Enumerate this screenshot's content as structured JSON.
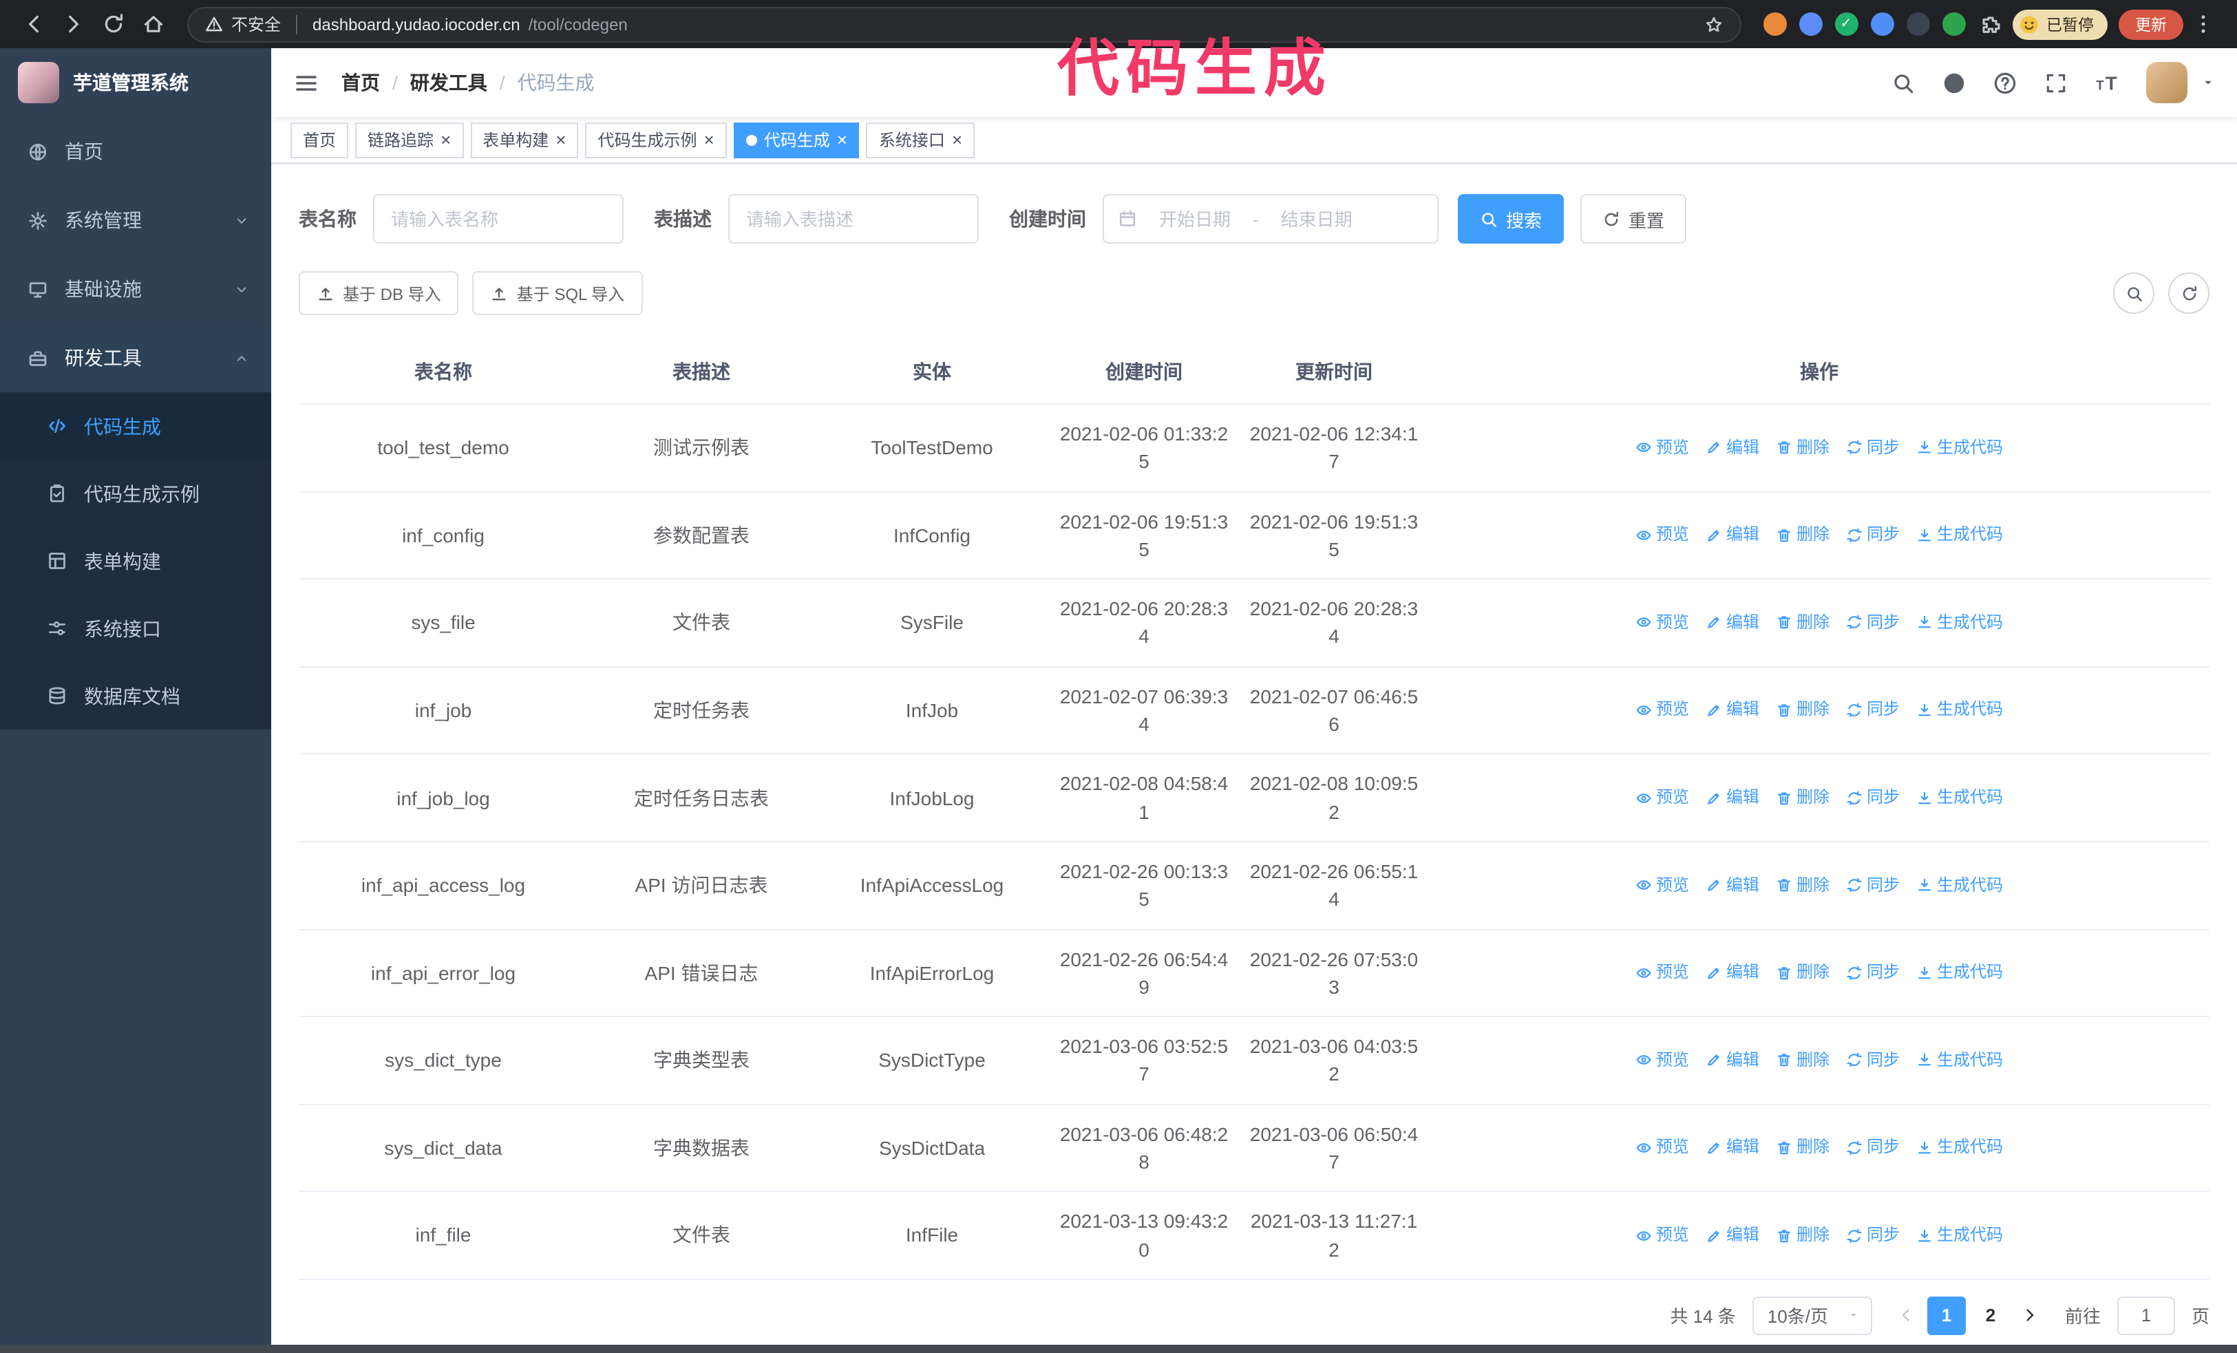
{
  "colors": {
    "accent": "#409eff",
    "annotation": "#f23a68",
    "sidebar_bg": "#304156",
    "submenu_bg": "#1f2d3d",
    "active_tab_bg": "#409eff"
  },
  "annotation": {
    "text": "代码生成",
    "color": "#f23a68"
  },
  "browser": {
    "security_label": "不安全",
    "url_host": "dashboard.yudao.iocoder.cn",
    "url_path": "/tool/codegen",
    "paused_badge": "已暂停",
    "update_button": "更新",
    "extensions": [
      {
        "name": "extension-orange-icon",
        "color": "#e98a3c"
      },
      {
        "name": "extension-blue-icon",
        "color": "#5b8cf7"
      },
      {
        "name": "extension-green-check-icon",
        "color": "#21b26e",
        "glyph": "✓"
      },
      {
        "name": "extension-share-icon",
        "color": "#4f8ef7"
      },
      {
        "name": "extension-switch-icon",
        "color": "#3b4350"
      },
      {
        "name": "extension-translate-icon",
        "color": "#2ea44f"
      }
    ]
  },
  "sidebar": {
    "app_title": "芋道管理系统",
    "items": [
      {
        "id": "home",
        "label": "首页",
        "icon": "home-icon",
        "has_children": false,
        "expanded": false
      },
      {
        "id": "system",
        "label": "系统管理",
        "icon": "gear-icon",
        "has_children": true,
        "expanded": false
      },
      {
        "id": "infra",
        "label": "基础设施",
        "icon": "infra-icon",
        "has_children": true,
        "expanded": false
      },
      {
        "id": "devtools",
        "label": "研发工具",
        "icon": "toolbox-icon",
        "has_children": true,
        "expanded": true,
        "children": [
          {
            "id": "codegen",
            "label": "代码生成",
            "icon": "code-icon",
            "active": true
          },
          {
            "id": "codegen-example",
            "label": "代码生成示例",
            "icon": "clipboard-icon",
            "active": false
          },
          {
            "id": "form-builder",
            "label": "表单构建",
            "icon": "form-icon",
            "active": false
          },
          {
            "id": "system-api",
            "label": "系统接口",
            "icon": "sliders-icon",
            "active": false
          },
          {
            "id": "db-doc",
            "label": "数据库文档",
            "icon": "database-icon",
            "active": false
          }
        ]
      }
    ]
  },
  "header": {
    "breadcrumb": [
      "首页",
      "研发工具",
      "代码生成"
    ],
    "separator": "/"
  },
  "tabbar": {
    "close_glyph": "×",
    "tabs": [
      {
        "label": "首页",
        "closable": false,
        "active": false
      },
      {
        "label": "链路追踪",
        "closable": true,
        "active": false
      },
      {
        "label": "表单构建",
        "closable": true,
        "active": false
      },
      {
        "label": "代码生成示例",
        "closable": true,
        "active": false
      },
      {
        "label": "代码生成",
        "closable": true,
        "active": true
      },
      {
        "label": "系统接口",
        "closable": true,
        "active": false
      }
    ]
  },
  "filters": {
    "table_name_label": "表名称",
    "table_name_placeholder": "请输入表名称",
    "table_desc_label": "表描述",
    "table_desc_placeholder": "请输入表描述",
    "create_time_label": "创建时间",
    "date_start_placeholder": "开始日期",
    "date_separator": "-",
    "date_end_placeholder": "结束日期",
    "search_button": "搜索",
    "reset_button": "重置"
  },
  "toolbar": {
    "import_db": "基于 DB 导入",
    "import_sql": "基于 SQL 导入"
  },
  "table": {
    "columns": [
      "表名称",
      "表描述",
      "实体",
      "创建时间",
      "更新时间",
      "操作"
    ],
    "row_actions": [
      {
        "id": "preview",
        "label": "预览",
        "icon": "eye-icon"
      },
      {
        "id": "edit",
        "label": "编辑",
        "icon": "edit-icon"
      },
      {
        "id": "delete",
        "label": "删除",
        "icon": "delete-icon"
      },
      {
        "id": "sync",
        "label": "同步",
        "icon": "sync-icon"
      },
      {
        "id": "generate",
        "label": "生成代码",
        "icon": "download-icon"
      }
    ],
    "rows": [
      {
        "name": "tool_test_demo",
        "desc": "测试示例表",
        "entity": "ToolTestDemo",
        "created": "2021-02-06 01:33:25",
        "updated": "2021-02-06 12:34:17"
      },
      {
        "name": "inf_config",
        "desc": "参数配置表",
        "entity": "InfConfig",
        "created": "2021-02-06 19:51:35",
        "updated": "2021-02-06 19:51:35"
      },
      {
        "name": "sys_file",
        "desc": "文件表",
        "entity": "SysFile",
        "created": "2021-02-06 20:28:34",
        "updated": "2021-02-06 20:28:34"
      },
      {
        "name": "inf_job",
        "desc": "定时任务表",
        "entity": "InfJob",
        "created": "2021-02-07 06:39:34",
        "updated": "2021-02-07 06:46:56"
      },
      {
        "name": "inf_job_log",
        "desc": "定时任务日志表",
        "entity": "InfJobLog",
        "created": "2021-02-08 04:58:41",
        "updated": "2021-02-08 10:09:52"
      },
      {
        "name": "inf_api_access_log",
        "desc": "API 访问日志表",
        "entity": "InfApiAccessLog",
        "created": "2021-02-26 00:13:35",
        "updated": "2021-02-26 06:55:14"
      },
      {
        "name": "inf_api_error_log",
        "desc": "API 错误日志",
        "entity": "InfApiErrorLog",
        "created": "2021-02-26 06:54:49",
        "updated": "2021-02-26 07:53:03"
      },
      {
        "name": "sys_dict_type",
        "desc": "字典类型表",
        "entity": "SysDictType",
        "created": "2021-03-06 03:52:57",
        "updated": "2021-03-06 04:03:52"
      },
      {
        "name": "sys_dict_data",
        "desc": "字典数据表",
        "entity": "SysDictData",
        "created": "2021-03-06 06:48:28",
        "updated": "2021-03-06 06:50:47"
      },
      {
        "name": "inf_file",
        "desc": "文件表",
        "entity": "InfFile",
        "created": "2021-03-13 09:43:20",
        "updated": "2021-03-13 11:27:12"
      }
    ]
  },
  "pagination": {
    "total_text": "共 14 条",
    "page_size": "10条/页",
    "pages": [
      "1",
      "2"
    ],
    "active_page": "1",
    "goto_label": "前往",
    "goto_value": "1",
    "goto_suffix": "页"
  }
}
